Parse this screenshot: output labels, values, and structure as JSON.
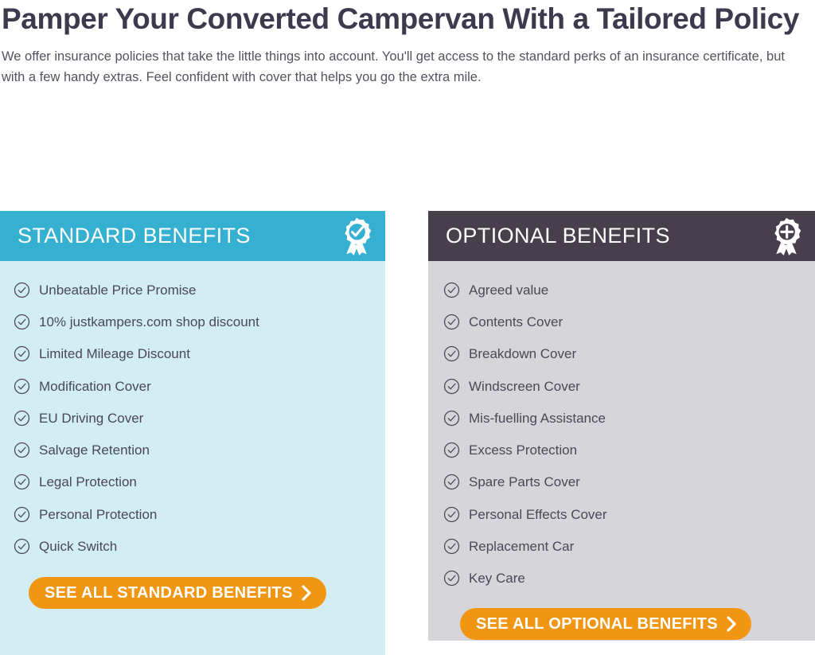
{
  "intro": {
    "title": "Pamper Your Converted Campervan With a Tailored Policy",
    "body": "We offer insurance policies that take the little things into account. You'll get access to the standard perks of an insurance certificate, but with a few handy extras. Feel confident with cover that helps you go the extra mile."
  },
  "colors": {
    "standard_header": "#35b0d0",
    "standard_body": "#d3edf5",
    "optional_header": "#483f4d",
    "optional_body": "#d6d6da",
    "cta_orange": "#f09612",
    "heading_text": "#3d3a4d",
    "body_text": "#54525f"
  },
  "cards": {
    "standard": {
      "header_title": "STANDARD BENEFITS",
      "header_icon": "rosette-check-icon",
      "item_icon": "circle-check-icon",
      "items": [
        {
          "label": "Unbeatable Price Promise"
        },
        {
          "label": "10% justkampers.com shop discount"
        },
        {
          "label": "Limited Mileage Discount"
        },
        {
          "label": "Modification Cover"
        },
        {
          "label": "EU Driving Cover"
        },
        {
          "label": "Salvage Retention"
        },
        {
          "label": "Legal Protection"
        },
        {
          "label": "Personal Protection"
        },
        {
          "label": "Quick Switch"
        }
      ],
      "cta": {
        "label": "SEE ALL STANDARD BENEFITS",
        "icon": "chevron-right-icon"
      }
    },
    "optional": {
      "header_title": "OPTIONAL BENEFITS",
      "header_icon": "rosette-plus-icon",
      "item_icon": "circle-check-icon",
      "items": [
        {
          "label": "Agreed value"
        },
        {
          "label": "Contents Cover"
        },
        {
          "label": "Breakdown Cover"
        },
        {
          "label": "Windscreen Cover"
        },
        {
          "label": "Mis-fuelling Assistance"
        },
        {
          "label": "Excess Protection"
        },
        {
          "label": "Spare Parts Cover"
        },
        {
          "label": "Personal Effects Cover"
        },
        {
          "label": "Replacement Car"
        },
        {
          "label": "Key Care"
        }
      ],
      "cta": {
        "label": "SEE ALL OPTIONAL BENEFITS",
        "icon": "chevron-right-icon"
      }
    }
  }
}
